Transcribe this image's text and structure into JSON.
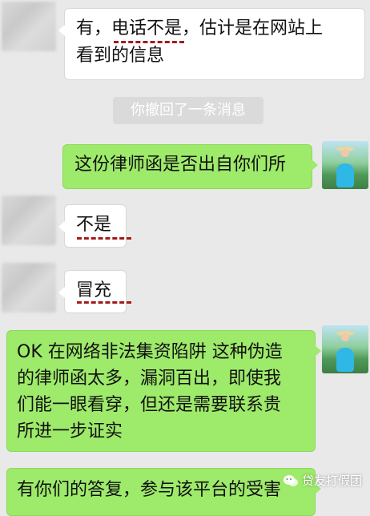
{
  "messages": [
    {
      "side": "in",
      "text_line1": "有，电话不是，估计是在网站上",
      "text_line2": "看到的信息"
    },
    {
      "side": "system",
      "text": "你撤回了一条消息"
    },
    {
      "side": "out",
      "text": "这份律师函是否出自你们所"
    },
    {
      "side": "in",
      "text": "不是"
    },
    {
      "side": "in",
      "text": "冒充"
    },
    {
      "side": "out",
      "lines": [
        "OK 在网络非法集资陷阱 这种伪造",
        "的律师函太多，漏洞百出，即使我",
        "们能一眼看穿，但还是需要联系贵",
        "所进一步证实"
      ]
    },
    {
      "side": "out",
      "text": "有你们的答复，参与该平台的受害"
    }
  ],
  "watermark": {
    "text": "贷友打假团",
    "icon": "wechat-icon"
  },
  "colors": {
    "background": "#e9e9e9",
    "outgoing": "#9eea6a",
    "incoming": "#ffffff",
    "underline": "#a01c1c"
  }
}
